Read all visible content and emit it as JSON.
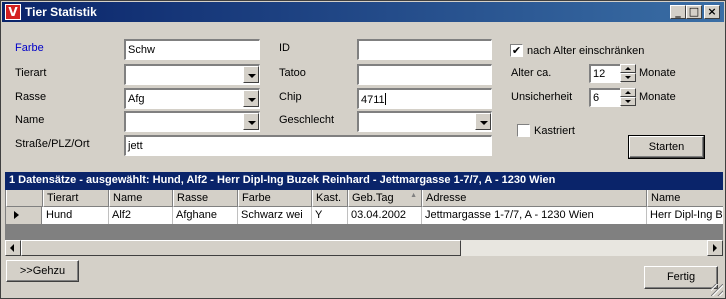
{
  "window": {
    "title": "Tier Statistik",
    "icon_letter": "V",
    "minimize": "_",
    "maximize": "□",
    "close": "×"
  },
  "form": {
    "farbe_label": "Farbe",
    "farbe_value": "Schw",
    "tierart_label": "Tierart",
    "tierart_value": "",
    "rasse_label": "Rasse",
    "rasse_value": "Afg",
    "name_label": "Name",
    "name_value": "",
    "strasse_label": "Straße/PLZ/Ort",
    "strasse_value": "jett",
    "id_label": "ID",
    "id_value": "",
    "tatoo_label": "Tatoo",
    "tatoo_value": "",
    "chip_label": "Chip",
    "chip_value": "4711",
    "geschlecht_label": "Geschlecht",
    "geschlecht_value": "",
    "alter_check_label": "nach Alter einschränken",
    "alter_check_mark": "✔",
    "alter_label": "Alter ca.",
    "alter_value": "12",
    "alter_unit": "Monate",
    "unsicherheit_label": "Unsicherheit",
    "unsicherheit_value": "6",
    "unsicherheit_unit": "Monate",
    "kastriert_label": "Kastriert",
    "starten_label": "Starten"
  },
  "grid": {
    "header_text": "1 Datensätze - ausgewählt: Hund, Alf2 - Herr Dipl-Ing Buzek Reinhard - Jettmargasse 1-7/7, A - 1230 Wien",
    "columns": [
      "Tierart",
      "Name",
      "Rasse",
      "Farbe",
      "Kast.",
      "Geb.Tag",
      "Adresse",
      "Name"
    ],
    "sort_glyph": "▲",
    "rows": [
      [
        "Hund",
        "Alf2",
        "Afghane",
        "Schwarz wei",
        "Y",
        "03.04.2002",
        "Jettmargasse  1-7/7, A - 1230 Wien",
        "Herr Dipl-Ing Bu"
      ]
    ]
  },
  "footer": {
    "gehzu_label": ">>Gehzu",
    "fertig_label": "Fertig"
  }
}
